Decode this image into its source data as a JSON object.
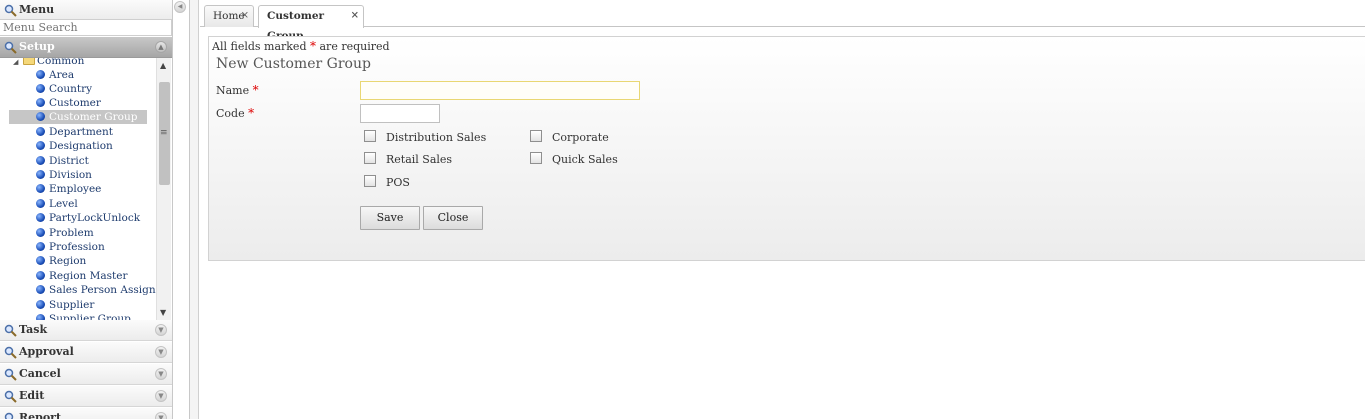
{
  "menu": {
    "title": "Menu",
    "search_placeholder": "Menu Search",
    "setup": {
      "title": "Setup",
      "folder": "Common",
      "items": [
        {
          "label": "Area"
        },
        {
          "label": "Country"
        },
        {
          "label": "Customer"
        },
        {
          "label": "Customer Group",
          "selected": true
        },
        {
          "label": "Department"
        },
        {
          "label": "Designation"
        },
        {
          "label": "District"
        },
        {
          "label": "Division"
        },
        {
          "label": "Employee"
        },
        {
          "label": "Level"
        },
        {
          "label": "PartyLockUnlock"
        },
        {
          "label": "Problem"
        },
        {
          "label": "Profession"
        },
        {
          "label": "Region"
        },
        {
          "label": "Region Master"
        },
        {
          "label": "Sales Person Assign"
        },
        {
          "label": "Supplier"
        },
        {
          "label": "Supplier Group"
        }
      ]
    },
    "sections": [
      {
        "title": "Task"
      },
      {
        "title": "Approval"
      },
      {
        "title": "Cancel"
      },
      {
        "title": "Edit"
      },
      {
        "title": "Report"
      }
    ]
  },
  "tabs": {
    "home": "Home",
    "customer_group": "Customer Group",
    "close_glyph": "×"
  },
  "form": {
    "required_note_pre": "All fields marked",
    "required_star": "*",
    "required_note_post": "are required",
    "title": "New Customer Group",
    "name_label": "Name",
    "code_label": "Code",
    "name_value": "",
    "code_value": "",
    "checkboxes": {
      "distribution_sales": "Distribution Sales",
      "corporate": "Corporate",
      "retail_sales": "Retail Sales",
      "quick_sales": "Quick Sales",
      "pos": "POS"
    },
    "save_label": "Save",
    "close_label": "Close"
  }
}
